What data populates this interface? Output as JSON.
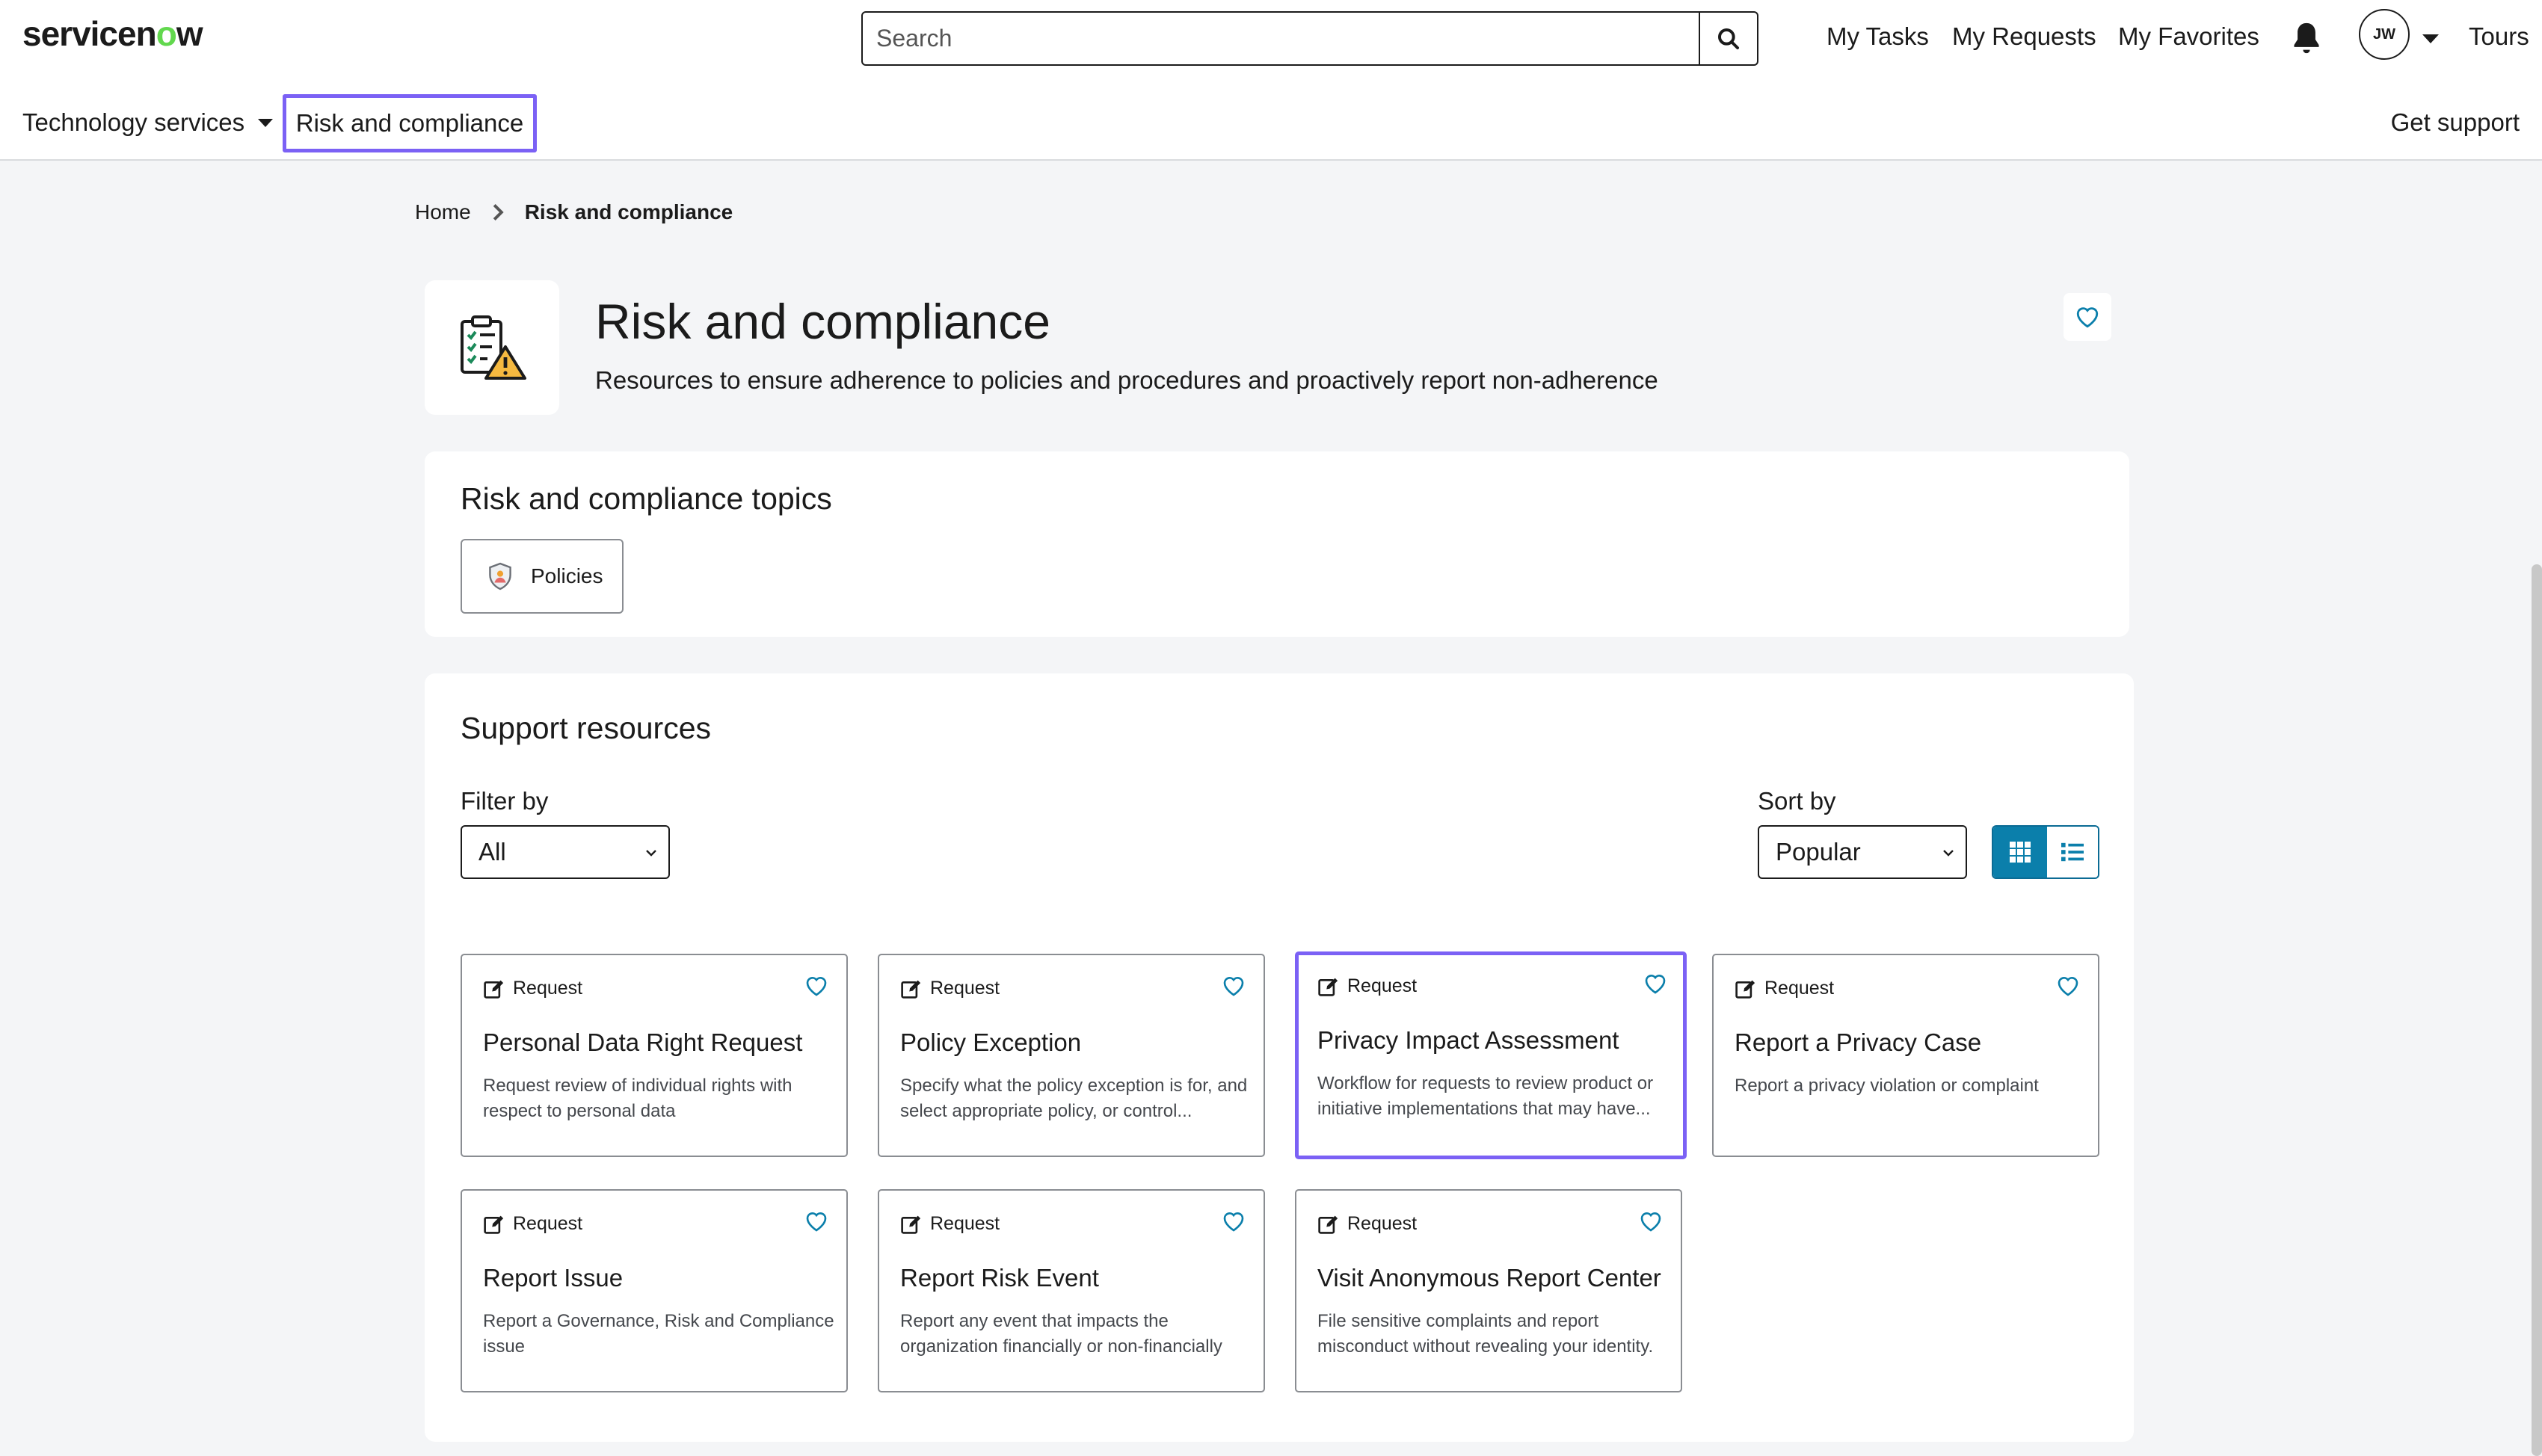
{
  "header": {
    "logo_text": "servicenow",
    "search_placeholder": "Search",
    "links": {
      "my_tasks": "My Tasks",
      "my_requests": "My Requests",
      "my_favorites": "My Favorites",
      "tours": "Tours"
    },
    "avatar_initials": "JW"
  },
  "nav": {
    "technology_services": "Technology services",
    "risk_and_compliance": "Risk and compliance",
    "get_support": "Get support"
  },
  "breadcrumb": {
    "home": "Home",
    "current": "Risk and compliance"
  },
  "hero": {
    "title": "Risk and compliance",
    "subtitle": "Resources to ensure adherence to policies and procedures and proactively report non-adherence"
  },
  "topics": {
    "heading": "Risk and compliance topics",
    "items": [
      {
        "label": "Policies"
      }
    ]
  },
  "support": {
    "heading": "Support resources",
    "filter_label": "Filter by",
    "filter_value": "All",
    "sort_label": "Sort by",
    "sort_value": "Popular",
    "cards": [
      {
        "type": "Request",
        "title": "Personal Data Right Request",
        "desc": "Request review of individual rights with respect to personal data"
      },
      {
        "type": "Request",
        "title": "Policy Exception",
        "desc": "Specify what the policy exception is for, and select appropriate policy, or control..."
      },
      {
        "type": "Request",
        "title": "Privacy Impact Assessment",
        "desc": "Workflow for requests to review product or initiative implementations that may have..."
      },
      {
        "type": "Request",
        "title": "Report a Privacy Case",
        "desc": "Report a privacy violation or complaint"
      },
      {
        "type": "Request",
        "title": "Report Issue",
        "desc": "Report a Governance, Risk and Compliance issue"
      },
      {
        "type": "Request",
        "title": "Report Risk Event",
        "desc": "Report any event that impacts the organization financially or non-financially"
      },
      {
        "type": "Request",
        "title": "Visit Anonymous Report Center",
        "desc": "File sensitive complaints and report misconduct without revealing your identity."
      }
    ]
  },
  "colors": {
    "accent": "#0b7fab",
    "highlight": "#7b61f5",
    "logo_green": "#62d84e"
  }
}
